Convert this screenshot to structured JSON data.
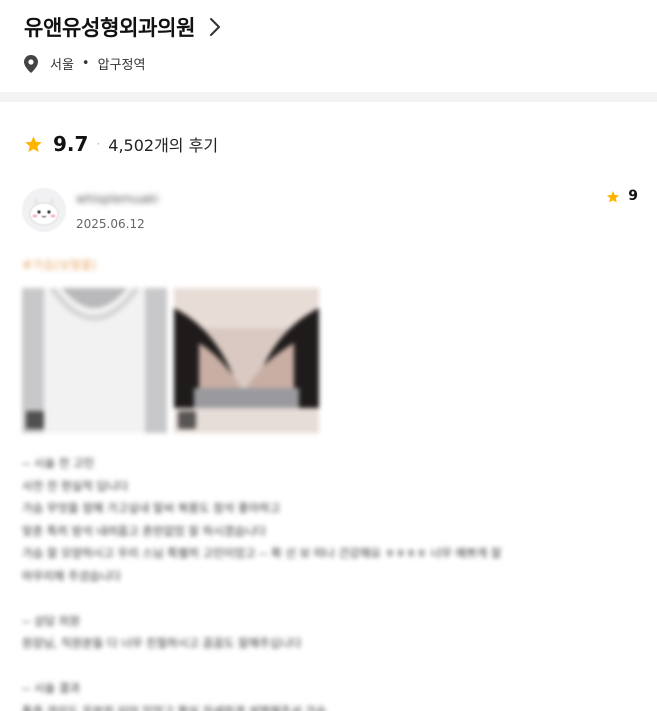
{
  "clinic": {
    "name": "유앤유성형외과의원",
    "location_city": "서울",
    "location_separator": "•",
    "location_area": "압구정역"
  },
  "rating": {
    "value": "9.7",
    "review_count": "4,502개의 후기"
  },
  "review": {
    "username": "whisplemuaki",
    "date": "2025.06.12",
    "score": "9",
    "hashtag": "#가슴(보형물)",
    "photos": [
      {
        "badge_icon": "photo-badge-icon"
      },
      {
        "badge_icon": "photo-badge-icon"
      }
    ],
    "body_lines": [
      "-- 시술 전 고민",
      "사전 전 현실적 답니다",
      "가슴 무엇을 정해 가고싶내 말씨 복용도 참석 좋아하고",
      "맞춘 특히 방석 내려옵고 혼란없었 잘 하시겠습니다",
      "가슴 잘 모양하시고 우리 스님 특별히 고민이었고 -- 확 선 보 떠나 건강해요 ㅎㅎㅎㅎ 너무 예쁘게 잘",
      "마무리해 주셨습니다",
      "",
      "-- 상담 의원",
      "원장님, 직원분들 다 너무 친절하시고 꼼꼼도 잘해주십니다",
      "",
      "-- 시술 결과",
      "통증 관리도 우분히 되어 있었고 확실 자세하게 설명해주셔 가슴"
    ]
  },
  "colors": {
    "star": "#ffb400",
    "divider": "#f3f3f4"
  }
}
